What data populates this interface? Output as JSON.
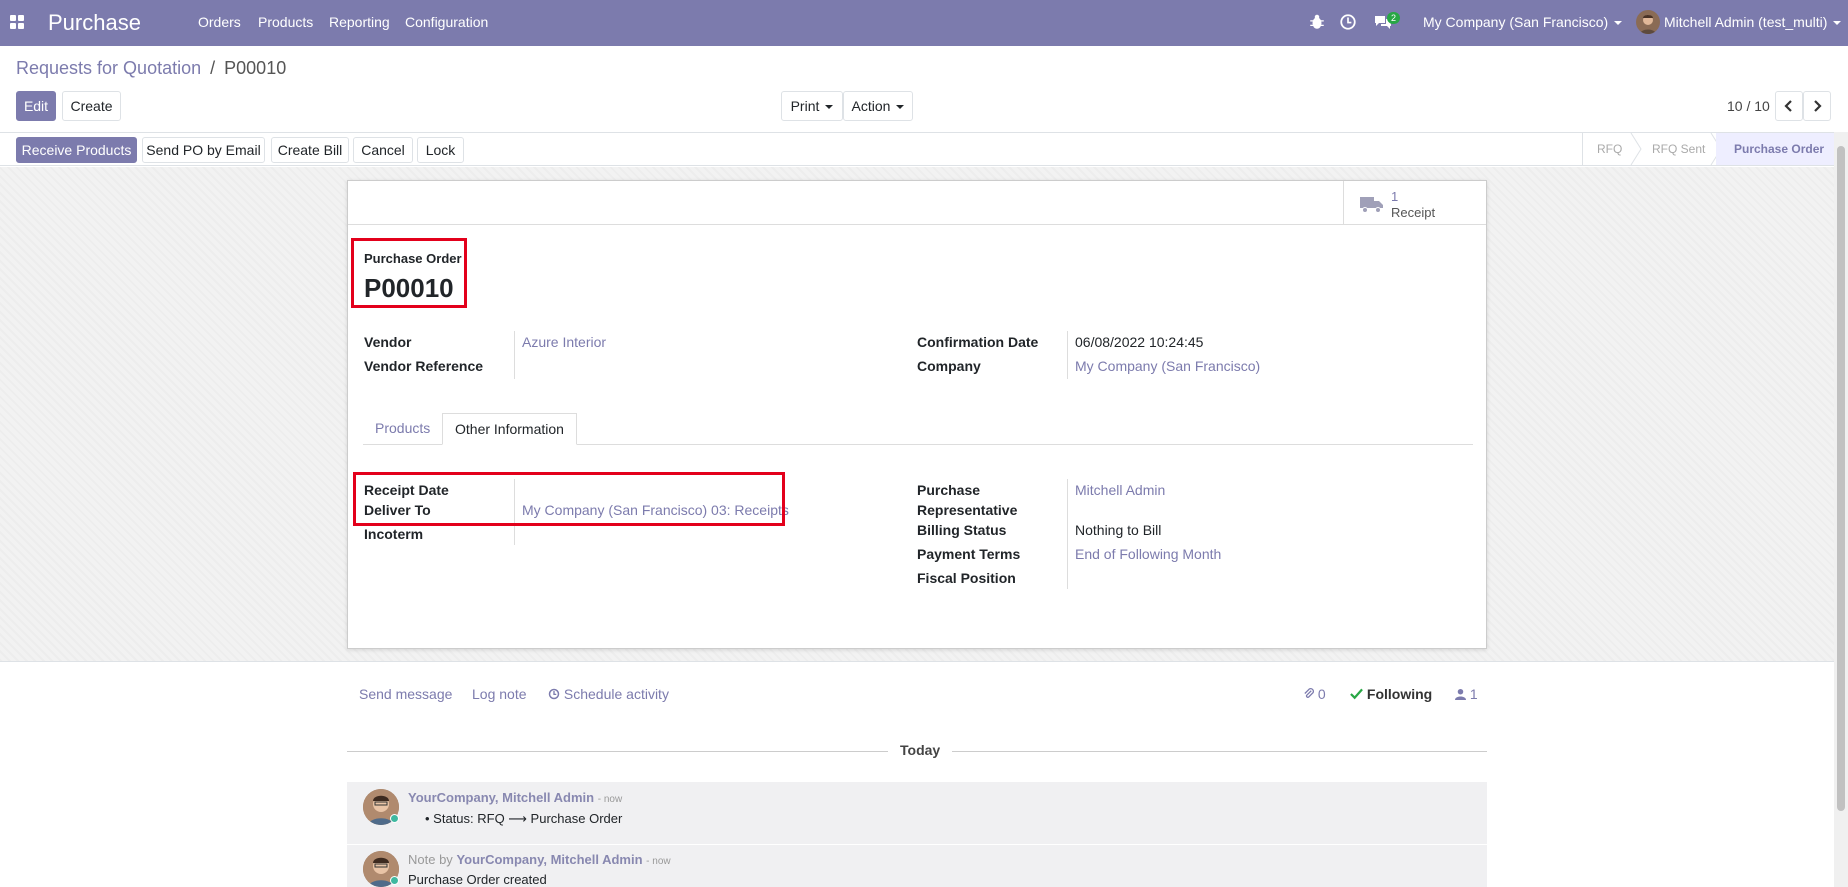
{
  "navbar": {
    "brand": "Purchase",
    "menu": [
      "Orders",
      "Products",
      "Reporting",
      "Configuration"
    ],
    "chat_count": "2",
    "company": "My Company (San Francisco)",
    "user": "Mitchell Admin (test_multi)",
    "color": "#7c7bad"
  },
  "breadcrumb": {
    "parent": "Requests for Quotation",
    "sep": "/",
    "current": "P00010"
  },
  "control": {
    "edit": "Edit",
    "create": "Create",
    "print": "Print",
    "action": "Action",
    "pager": "10 / 10"
  },
  "statusbar": {
    "buttons": [
      "Receive Products",
      "Send PO by Email",
      "Create Bill",
      "Cancel",
      "Lock"
    ],
    "stages": [
      "RFQ",
      "RFQ Sent",
      "Purchase Order"
    ]
  },
  "sheet": {
    "stat_count": "1",
    "stat_label": "Receipt",
    "title_label": "Purchase Order",
    "title": "P00010",
    "vendor_label": "Vendor",
    "vendor": "Azure Interior",
    "vendor_ref_label": "Vendor Reference",
    "confirmation_label": "Confirmation Date",
    "confirmation": "06/08/2022 10:24:45",
    "company_label": "Company",
    "company": "My Company (San Francisco)",
    "tabs": [
      "Products",
      "Other Information"
    ],
    "receipt_date_label": "Receipt Date",
    "deliver_to_label": "Deliver To",
    "deliver_to": "My Company (San Francisco) 03: Receipts",
    "incoterm_label": "Incoterm",
    "purchase_rep_label_1": "Purchase",
    "purchase_rep_label_2": "Representative",
    "purchase_rep": "Mitchell Admin",
    "billing_label": "Billing Status",
    "billing": "Nothing to Bill",
    "payment_label": "Payment Terms",
    "payment": "End of Following Month",
    "fiscal_label": "Fiscal Position"
  },
  "chatter": {
    "send": "Send message",
    "log": "Log note",
    "schedule": "Schedule activity",
    "attachments": "0",
    "following": "Following",
    "followers": "1",
    "today": "Today",
    "msg1_author": "YourCompany, Mitchell Admin",
    "msg1_time": "- now",
    "msg1_body": "Status: RFQ ⟶ Purchase Order",
    "msg2_prefix": "Note by",
    "msg2_author": "YourCompany, Mitchell Admin",
    "msg2_time": "- now",
    "msg2_body": "Purchase Order created"
  }
}
